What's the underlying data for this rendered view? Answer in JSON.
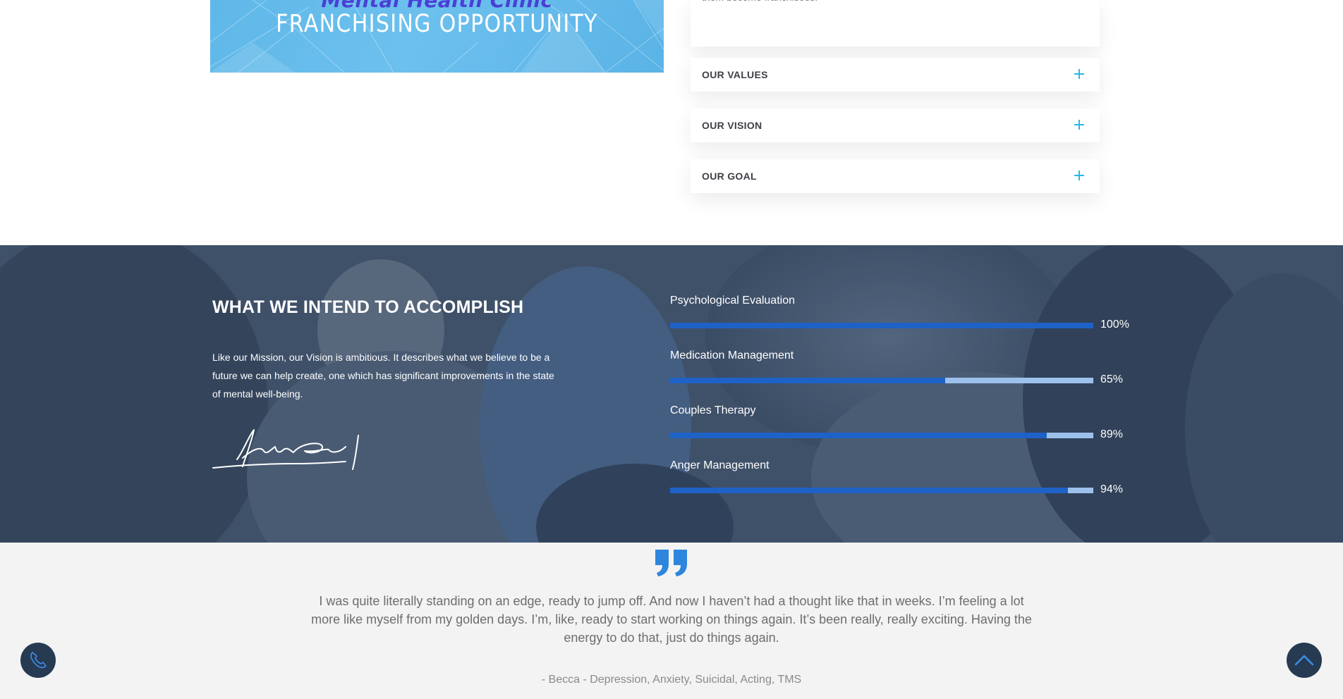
{
  "banner": {
    "subtitle": "Mental Health Clinic",
    "title": "FRANCHISING OPPORTUNITY"
  },
  "about_card": {
    "text": "them become franchisees."
  },
  "accordion": [
    {
      "label": "OUR VALUES"
    },
    {
      "label": "OUR VISION"
    },
    {
      "label": "OUR GOAL"
    }
  ],
  "accomplish": {
    "heading": "WHAT WE INTEND TO ACCOMPLISH",
    "paragraph": "Like our Mission, our Vision is ambitious. It describes what we believe to be a future we can help create, one which has significant improvements in the state of mental well-being."
  },
  "skills": [
    {
      "name": "Psychological Evaluation",
      "value": 100,
      "label": "100%"
    },
    {
      "name": "Medication Management",
      "value": 65,
      "label": "65%"
    },
    {
      "name": "Couples Therapy",
      "value": 89,
      "label": "89%"
    },
    {
      "name": "Anger Management",
      "value": 94,
      "label": "94%"
    }
  ],
  "testimonial": {
    "quote": "I was quite literally standing on an edge, ready to jump off. And now I haven’t had a thought like that in weeks. I’m feeling a lot more like myself from my golden days. I’m, like, ready to start working on things again. It’s been really, really exciting. Having the energy to do that, just do things again.",
    "author": "- Becca - Depression, Anxiety, Suicidal, Acting, TMS"
  },
  "icons": {
    "phone": "phone-icon",
    "scroll_top": "chevron-up-icon",
    "quote": "quote-icon",
    "expand": "plus-icon"
  },
  "colors": {
    "accent_blue": "#1e62c7",
    "track_light": "#9dc1ec",
    "plus_cyan": "#29b6e8",
    "fab_bg": "#263a52"
  }
}
